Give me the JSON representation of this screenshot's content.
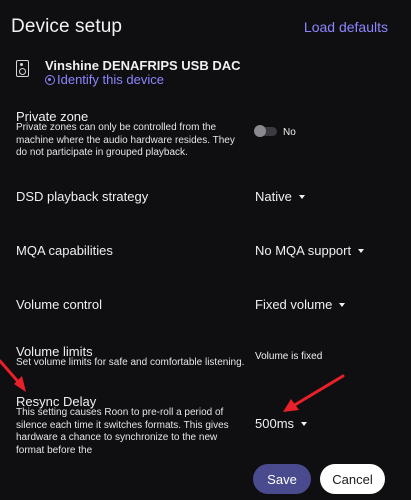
{
  "dialog": {
    "title": "Device setup",
    "load_defaults_label": "Load defaults"
  },
  "device": {
    "icon": "speaker-icon",
    "name": "Vinshine DENAFRIPS USB DAC",
    "identify_label": "Identify this device",
    "identify_icon": "identify-icon"
  },
  "settings": {
    "private_zone": {
      "label": "Private zone",
      "description": "Private zones can only be controlled from the machine where the audio hardware resides. They do not participate in grouped playback.",
      "toggle_state": "off",
      "toggle_label": "No"
    },
    "dsd_strategy": {
      "label": "DSD playback strategy",
      "value": "Native"
    },
    "mqa": {
      "label": "MQA capabilities",
      "value": "No MQA support"
    },
    "volume_control": {
      "label": "Volume control",
      "value": "Fixed volume"
    },
    "volume_limits": {
      "label": "Volume limits",
      "description": "Set volume limits for safe and comfortable listening.",
      "value": "Volume is fixed"
    },
    "resync_delay": {
      "label": "Resync Delay",
      "description": "This setting causes Roon to pre-roll a period of silence each time it switches formats. This gives hardware a chance to synchronize to the new format before the",
      "value": "500ms"
    }
  },
  "footer": {
    "save_label": "Save",
    "cancel_label": "Cancel"
  },
  "colors": {
    "background": "#0f0f11",
    "accent": "#8c86ff",
    "save_button": "#4a4a8e",
    "annotation_arrow": "#e8202a"
  }
}
